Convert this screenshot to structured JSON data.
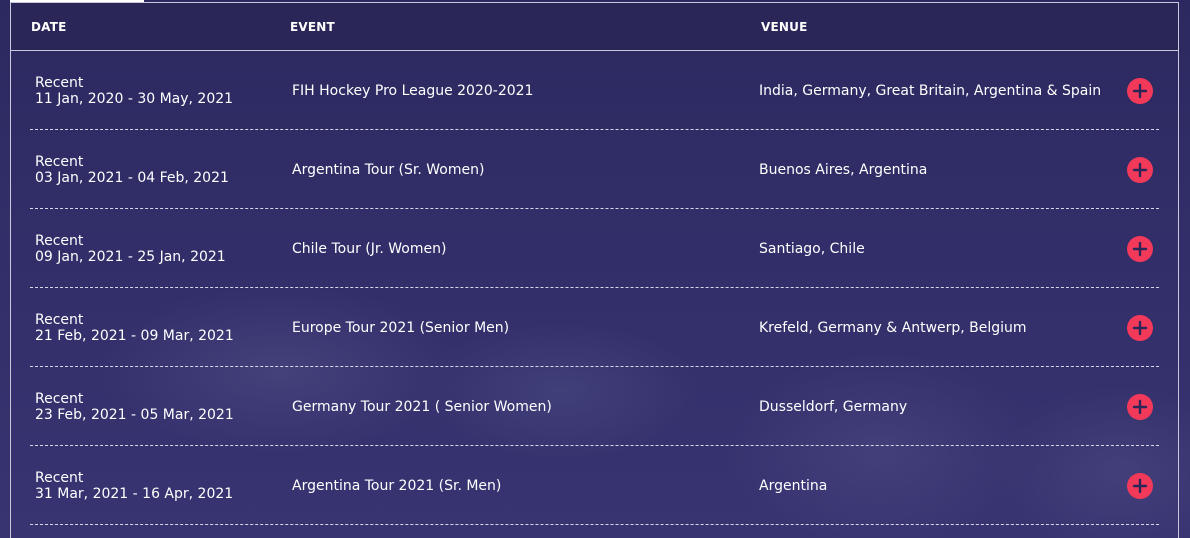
{
  "table": {
    "headers": {
      "date": "DATE",
      "event": "EVENT",
      "venue": "VENUE"
    },
    "rows": [
      {
        "status": "Recent",
        "dates": "11 Jan, 2020 - 30 May, 2021",
        "event": "FIH Hockey Pro League 2020-2021",
        "venue": "India, Germany, Great Britain, Argentina & Spain"
      },
      {
        "status": "Recent",
        "dates": "03 Jan, 2021 - 04 Feb, 2021",
        "event": "Argentina Tour (Sr. Women)",
        "venue": "Buenos Aires, Argentina"
      },
      {
        "status": "Recent",
        "dates": "09 Jan, 2021 - 25 Jan, 2021",
        "event": "Chile Tour (Jr. Women)",
        "venue": "Santiago, Chile"
      },
      {
        "status": "Recent",
        "dates": "21 Feb, 2021 - 09 Mar, 2021",
        "event": "Europe Tour 2021 (Senior Men)",
        "venue": "Krefeld, Germany & Antwerp, Belgium"
      },
      {
        "status": "Recent",
        "dates": "23 Feb, 2021 - 05 Mar, 2021",
        "event": "Germany Tour 2021 ( Senior Women)",
        "venue": "Dusseldorf, Germany"
      },
      {
        "status": "Recent",
        "dates": "31 Mar, 2021 - 16 Apr, 2021",
        "event": "Argentina Tour 2021 (Sr. Men)",
        "venue": "Argentina"
      }
    ]
  },
  "icons": {
    "expand": "plus-icon"
  },
  "colors": {
    "background": "#2e2b63",
    "header_background": "#2a2758",
    "accent": "#f2395a",
    "text": "#ffffff"
  }
}
